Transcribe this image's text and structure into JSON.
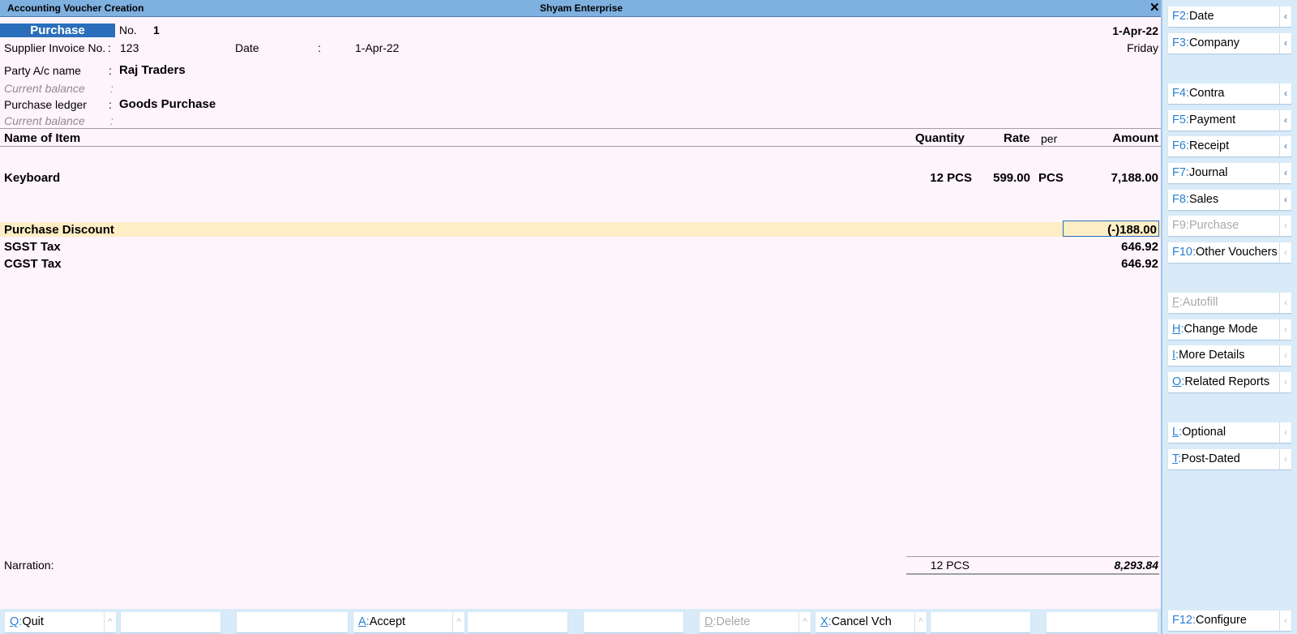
{
  "window": {
    "title": "Accounting Voucher Creation",
    "company": "Shyam Enterprise",
    "close_glyph": "✕"
  },
  "voucher": {
    "type_label": "Purchase",
    "no_label": "No.",
    "no_value": "1",
    "date_right": "1-Apr-22",
    "day_right": "Friday",
    "supplier_inv_label": "Supplier Invoice No.",
    "supplier_inv_colon": ":",
    "supplier_inv_value": "123",
    "date_label": "Date",
    "date_colon": ":",
    "date_value": "1-Apr-22",
    "party_label": "Party A/c name",
    "party_colon": ":",
    "party_value": "Raj Traders",
    "cur_bal_label": "Current balance",
    "cur_bal_colon": ":",
    "purchase_ledger_label": "Purchase ledger",
    "purchase_ledger_colon": ":",
    "purchase_ledger_value": "Goods Purchase",
    "cur_bal2_label": "Current balance",
    "cur_bal2_colon": ":"
  },
  "table": {
    "headers": {
      "name": "Name of Item",
      "quantity": "Quantity",
      "rate": "Rate",
      "per": "per",
      "amount": "Amount"
    },
    "items": [
      {
        "name": "Keyboard",
        "quantity": "12 PCS",
        "rate": "599.00",
        "per": "PCS",
        "amount": "7,188.00"
      }
    ],
    "ledgers": [
      {
        "name": "Purchase Discount",
        "amount": "(-)188.00"
      },
      {
        "name": "SGST Tax",
        "amount": "646.92"
      },
      {
        "name": "CGST Tax",
        "amount": "646.92"
      }
    ]
  },
  "footer": {
    "narration_label": "Narration:",
    "total_quantity": "12 PCS",
    "total_amount": "8,293.84"
  },
  "sidebar": {
    "arrow_glyph": "‹",
    "buttons": [
      {
        "key": "F2",
        "sep": ":",
        "label": "Date",
        "disabled": false
      },
      {
        "key": "F3",
        "sep": ":",
        "label": "Company",
        "disabled": false
      },
      {
        "key": "F4",
        "sep": ":",
        "label": "Contra",
        "disabled": false
      },
      {
        "key": "F5",
        "sep": ":",
        "label": "Payment",
        "disabled": false
      },
      {
        "key": "F6",
        "sep": ":",
        "label": "Receipt",
        "disabled": false
      },
      {
        "key": "F7",
        "sep": ":",
        "label": "Journal",
        "disabled": false
      },
      {
        "key": "F8",
        "sep": ":",
        "label": "Sales",
        "disabled": false
      },
      {
        "key": "F9",
        "sep": ":",
        "label": "Purchase",
        "disabled": true
      },
      {
        "key": "F10",
        "sep": ":",
        "label": "Other Vouchers",
        "disabled": false
      },
      {
        "key": "F",
        "sep": ":",
        "label": "Autofill",
        "disabled": true
      },
      {
        "key": "H",
        "sep": ":",
        "label": "Change Mode",
        "disabled": false
      },
      {
        "key": "I",
        "sep": ":",
        "label": "More Details",
        "disabled": false
      },
      {
        "key": "O",
        "sep": ":",
        "label": "Related Reports",
        "disabled": false
      },
      {
        "key": "L",
        "sep": ":",
        "label": "Optional",
        "disabled": false
      },
      {
        "key": "T",
        "sep": ":",
        "label": "Post-Dated",
        "disabled": false
      },
      {
        "key": "F12",
        "sep": ":",
        "label": "Configure",
        "disabled": false
      }
    ]
  },
  "bottombar": {
    "arrow_glyph": "^",
    "buttons": [
      {
        "key": "Q",
        "sep": ":",
        "label": "Quit",
        "disabled": false
      },
      {
        "key": "",
        "sep": "",
        "label": "",
        "disabled": false
      },
      {
        "key": "",
        "sep": "",
        "label": "",
        "disabled": false
      },
      {
        "key": "A",
        "sep": ":",
        "label": "Accept",
        "disabled": false
      },
      {
        "key": "",
        "sep": "",
        "label": "",
        "disabled": false
      },
      {
        "key": "",
        "sep": "",
        "label": "",
        "disabled": false
      },
      {
        "key": "D",
        "sep": ":",
        "label": "Delete",
        "disabled": true
      },
      {
        "key": "X",
        "sep": ":",
        "label": "Cancel Vch",
        "disabled": false
      },
      {
        "key": "",
        "sep": "",
        "label": "",
        "disabled": false
      },
      {
        "key": "",
        "sep": "",
        "label": "",
        "disabled": false
      }
    ]
  },
  "colors": {
    "title_bar": "#7eb0e0",
    "form_bg": "#fef4fb",
    "voucher_type_bg": "#2a6ebb",
    "highlight_row": "#feeec5",
    "sidebar_bg": "#d9ebf8",
    "key_blue": "#2a7fd0"
  }
}
